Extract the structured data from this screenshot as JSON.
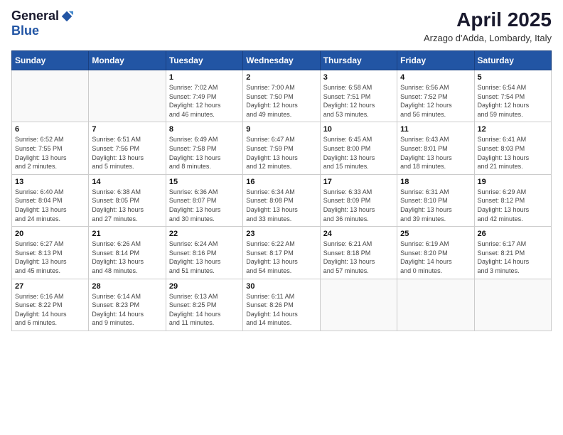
{
  "header": {
    "logo_general": "General",
    "logo_blue": "Blue",
    "title": "April 2025",
    "subtitle": "Arzago d'Adda, Lombardy, Italy"
  },
  "days_of_week": [
    "Sunday",
    "Monday",
    "Tuesday",
    "Wednesday",
    "Thursday",
    "Friday",
    "Saturday"
  ],
  "weeks": [
    [
      {
        "day": "",
        "info": ""
      },
      {
        "day": "",
        "info": ""
      },
      {
        "day": "1",
        "info": "Sunrise: 7:02 AM\nSunset: 7:49 PM\nDaylight: 12 hours\nand 46 minutes."
      },
      {
        "day": "2",
        "info": "Sunrise: 7:00 AM\nSunset: 7:50 PM\nDaylight: 12 hours\nand 49 minutes."
      },
      {
        "day": "3",
        "info": "Sunrise: 6:58 AM\nSunset: 7:51 PM\nDaylight: 12 hours\nand 53 minutes."
      },
      {
        "day": "4",
        "info": "Sunrise: 6:56 AM\nSunset: 7:52 PM\nDaylight: 12 hours\nand 56 minutes."
      },
      {
        "day": "5",
        "info": "Sunrise: 6:54 AM\nSunset: 7:54 PM\nDaylight: 12 hours\nand 59 minutes."
      }
    ],
    [
      {
        "day": "6",
        "info": "Sunrise: 6:52 AM\nSunset: 7:55 PM\nDaylight: 13 hours\nand 2 minutes."
      },
      {
        "day": "7",
        "info": "Sunrise: 6:51 AM\nSunset: 7:56 PM\nDaylight: 13 hours\nand 5 minutes."
      },
      {
        "day": "8",
        "info": "Sunrise: 6:49 AM\nSunset: 7:58 PM\nDaylight: 13 hours\nand 8 minutes."
      },
      {
        "day": "9",
        "info": "Sunrise: 6:47 AM\nSunset: 7:59 PM\nDaylight: 13 hours\nand 12 minutes."
      },
      {
        "day": "10",
        "info": "Sunrise: 6:45 AM\nSunset: 8:00 PM\nDaylight: 13 hours\nand 15 minutes."
      },
      {
        "day": "11",
        "info": "Sunrise: 6:43 AM\nSunset: 8:01 PM\nDaylight: 13 hours\nand 18 minutes."
      },
      {
        "day": "12",
        "info": "Sunrise: 6:41 AM\nSunset: 8:03 PM\nDaylight: 13 hours\nand 21 minutes."
      }
    ],
    [
      {
        "day": "13",
        "info": "Sunrise: 6:40 AM\nSunset: 8:04 PM\nDaylight: 13 hours\nand 24 minutes."
      },
      {
        "day": "14",
        "info": "Sunrise: 6:38 AM\nSunset: 8:05 PM\nDaylight: 13 hours\nand 27 minutes."
      },
      {
        "day": "15",
        "info": "Sunrise: 6:36 AM\nSunset: 8:07 PM\nDaylight: 13 hours\nand 30 minutes."
      },
      {
        "day": "16",
        "info": "Sunrise: 6:34 AM\nSunset: 8:08 PM\nDaylight: 13 hours\nand 33 minutes."
      },
      {
        "day": "17",
        "info": "Sunrise: 6:33 AM\nSunset: 8:09 PM\nDaylight: 13 hours\nand 36 minutes."
      },
      {
        "day": "18",
        "info": "Sunrise: 6:31 AM\nSunset: 8:10 PM\nDaylight: 13 hours\nand 39 minutes."
      },
      {
        "day": "19",
        "info": "Sunrise: 6:29 AM\nSunset: 8:12 PM\nDaylight: 13 hours\nand 42 minutes."
      }
    ],
    [
      {
        "day": "20",
        "info": "Sunrise: 6:27 AM\nSunset: 8:13 PM\nDaylight: 13 hours\nand 45 minutes."
      },
      {
        "day": "21",
        "info": "Sunrise: 6:26 AM\nSunset: 8:14 PM\nDaylight: 13 hours\nand 48 minutes."
      },
      {
        "day": "22",
        "info": "Sunrise: 6:24 AM\nSunset: 8:16 PM\nDaylight: 13 hours\nand 51 minutes."
      },
      {
        "day": "23",
        "info": "Sunrise: 6:22 AM\nSunset: 8:17 PM\nDaylight: 13 hours\nand 54 minutes."
      },
      {
        "day": "24",
        "info": "Sunrise: 6:21 AM\nSunset: 8:18 PM\nDaylight: 13 hours\nand 57 minutes."
      },
      {
        "day": "25",
        "info": "Sunrise: 6:19 AM\nSunset: 8:20 PM\nDaylight: 14 hours\nand 0 minutes."
      },
      {
        "day": "26",
        "info": "Sunrise: 6:17 AM\nSunset: 8:21 PM\nDaylight: 14 hours\nand 3 minutes."
      }
    ],
    [
      {
        "day": "27",
        "info": "Sunrise: 6:16 AM\nSunset: 8:22 PM\nDaylight: 14 hours\nand 6 minutes."
      },
      {
        "day": "28",
        "info": "Sunrise: 6:14 AM\nSunset: 8:23 PM\nDaylight: 14 hours\nand 9 minutes."
      },
      {
        "day": "29",
        "info": "Sunrise: 6:13 AM\nSunset: 8:25 PM\nDaylight: 14 hours\nand 11 minutes."
      },
      {
        "day": "30",
        "info": "Sunrise: 6:11 AM\nSunset: 8:26 PM\nDaylight: 14 hours\nand 14 minutes."
      },
      {
        "day": "",
        "info": ""
      },
      {
        "day": "",
        "info": ""
      },
      {
        "day": "",
        "info": ""
      }
    ]
  ]
}
